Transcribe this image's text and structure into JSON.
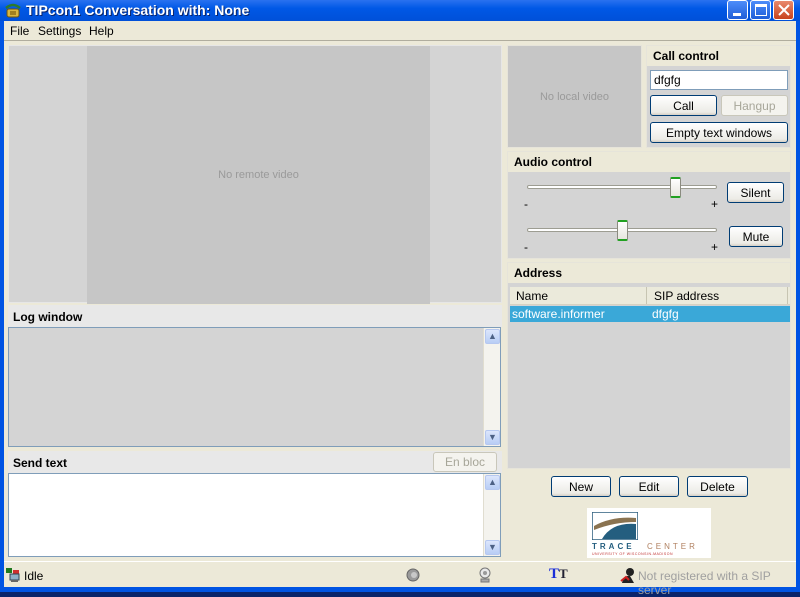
{
  "window": {
    "title": "TIPcon1 Conversation with: None",
    "minimize_label": "_",
    "maximize_label": "□",
    "close_label": "✕"
  },
  "menu": {
    "items": [
      {
        "label": "File"
      },
      {
        "label": "Settings"
      },
      {
        "label": "Help"
      }
    ]
  },
  "video": {
    "remote_placeholder": "No remote video",
    "local_placeholder": "No local video"
  },
  "log": {
    "header": "Log window",
    "content": ""
  },
  "send_text": {
    "header": "Send text",
    "en_bloc_label": "En bloc",
    "content": ""
  },
  "call_control": {
    "header": "Call control",
    "address_value": "dfgfg",
    "call_label": "Call",
    "hangup_label": "Hangup",
    "empty_text_label": "Empty text windows"
  },
  "audio_control": {
    "header": "Audio control",
    "speaker_volume": 0.8,
    "microphone_volume": 0.5,
    "minus_label": "-",
    "plus_label": "+",
    "silent_label": "Silent",
    "mute_label": "Mute"
  },
  "address": {
    "header": "Address",
    "columns": [
      "Name",
      "SIP address"
    ],
    "rows": [
      {
        "name": "software.informer",
        "sip": "dfgfg",
        "selected": true
      }
    ],
    "new_label": "New",
    "edit_label": "Edit",
    "delete_label": "Delete"
  },
  "logo": {
    "title": "TRACE CENTER",
    "trace": "TRACE",
    "center": "CENTER",
    "subtitle": "UNIVERSITY OF WISCONSIN-MADISON"
  },
  "status": {
    "connection_state": "Idle",
    "sip_status": "Not registered with a SIP server",
    "icons": [
      "network-icon",
      "speaker-icon",
      "webcam-icon",
      "text-icon",
      "sip-user-icon"
    ]
  },
  "colors": {
    "selection": "#3aa8d8",
    "titlebar": "#0058e6"
  }
}
